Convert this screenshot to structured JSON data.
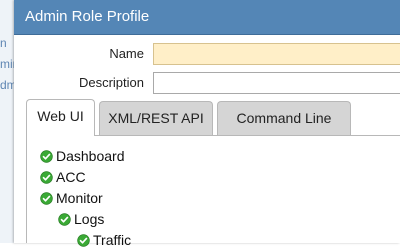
{
  "background_page": {
    "fragments": [
      "n",
      "min",
      "dm"
    ]
  },
  "dialog": {
    "title": "Admin Role Profile",
    "fields": {
      "name": {
        "label": "Name",
        "value": ""
      },
      "description": {
        "label": "Description",
        "value": ""
      }
    },
    "tabs": [
      "Web UI",
      "XML/REST API",
      "Command Line"
    ],
    "active_tab": "Web UI",
    "tree": [
      {
        "label": "Dashboard",
        "level": 0
      },
      {
        "label": "ACC",
        "level": 0
      },
      {
        "label": "Monitor",
        "level": 0
      },
      {
        "label": "Logs",
        "level": 1
      },
      {
        "label": "Traffic",
        "level": 2
      }
    ]
  },
  "icons": {
    "enabled": "green-check-circle-icon"
  },
  "colors": {
    "title_bar": "#5486b6",
    "required_field": "#ffefc8",
    "check_green": "#3aa935"
  }
}
